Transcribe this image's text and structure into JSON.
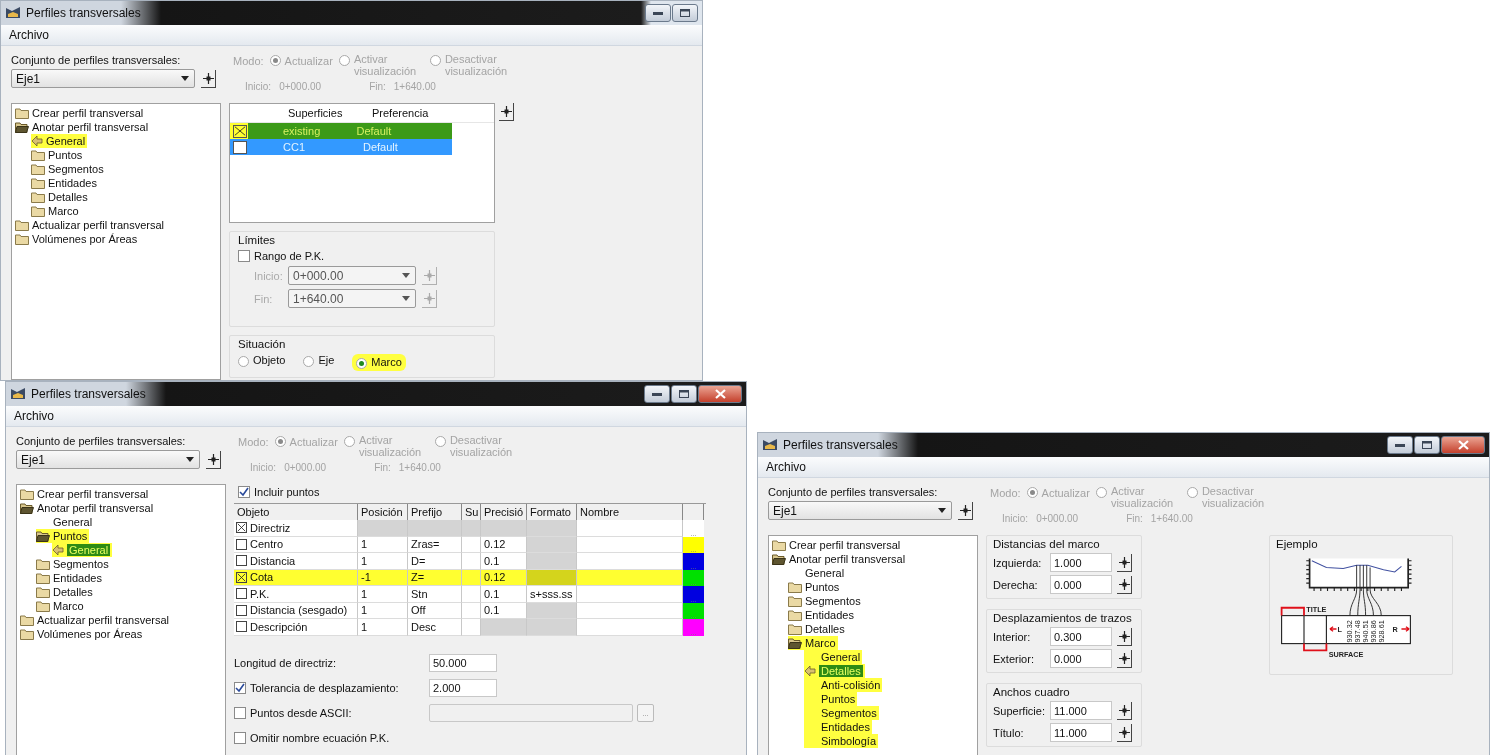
{
  "windows": [
    {
      "title": "Perfiles transversales",
      "close_visible": false,
      "menu": [
        "Archivo"
      ],
      "set_label": "Conjunto de perfiles transversales:",
      "set_value": "Eje1",
      "mode": {
        "label": "Modo:",
        "disabled": true,
        "options": [
          {
            "label": "Actualizar",
            "selected": true
          },
          {
            "label": "Activar visualización",
            "selected": false
          },
          {
            "label": "Desactivar visualización",
            "selected": false
          }
        ]
      },
      "start": {
        "label": "Inicio:",
        "value": "0+000.00"
      },
      "end": {
        "label": "Fin:",
        "value": "1+640.00"
      },
      "tree": [
        {
          "label": "Crear perfil transversal",
          "kind": "folder",
          "selected": false,
          "highlighted": false
        },
        {
          "label": "Anotar perfil transversal",
          "kind": "folder-open",
          "selected": false,
          "highlighted": false,
          "children": [
            {
              "label": "General",
              "kind": "current",
              "selected": false,
              "highlighted": true
            },
            {
              "label": "Puntos",
              "kind": "folder",
              "selected": false,
              "highlighted": false
            },
            {
              "label": "Segmentos",
              "kind": "folder",
              "selected": false,
              "highlighted": false
            },
            {
              "label": "Entidades",
              "kind": "folder",
              "selected": false,
              "highlighted": false
            },
            {
              "label": "Detalles",
              "kind": "folder",
              "selected": false,
              "highlighted": false
            },
            {
              "label": "Marco",
              "kind": "folder",
              "selected": false,
              "highlighted": false
            }
          ]
        },
        {
          "label": "Actualizar perfil transversal",
          "kind": "folder",
          "selected": false,
          "highlighted": false
        },
        {
          "label": "Volúmenes por Áreas",
          "kind": "folder",
          "selected": false,
          "highlighted": false
        }
      ],
      "pane": {
        "kind": "surfaces",
        "columns": [
          "Superficies",
          "Preferencia"
        ],
        "rows": [
          {
            "checked": true,
            "surface": "existing",
            "preference": "Default",
            "selected": true,
            "highlighted": true
          },
          {
            "checked": false,
            "surface": "CC1",
            "preference": "Default",
            "selected": true,
            "highlighted": false
          }
        ],
        "limits": {
          "title": "Límites",
          "range": {
            "label": "Rango de P.K.",
            "checked": false
          },
          "fields": [
            {
              "label": "Inicio:",
              "value": "0+000.00",
              "disabled": true
            },
            {
              "label": "Fin:",
              "value": "1+640.00",
              "disabled": true
            }
          ]
        },
        "placement": {
          "title": "Situación",
          "options": [
            {
              "label": "Objeto",
              "selected": false,
              "highlighted": false
            },
            {
              "label": "Eje",
              "selected": false,
              "highlighted": false
            },
            {
              "label": "Marco",
              "selected": true,
              "highlighted": true
            }
          ]
        }
      }
    },
    {
      "title": "Perfiles transversales",
      "close_visible": true,
      "menu": [
        "Archivo"
      ],
      "set_label": "Conjunto de perfiles transversales:",
      "set_value": "Eje1",
      "mode": {
        "label": "Modo:",
        "disabled": true,
        "options": [
          {
            "label": "Actualizar",
            "selected": true
          },
          {
            "label": "Activar visualización",
            "selected": false
          },
          {
            "label": "Desactivar visualización",
            "selected": false
          }
        ]
      },
      "start": {
        "label": "Inicio:",
        "value": "0+000.00"
      },
      "end": {
        "label": "Fin:",
        "value": "1+640.00"
      },
      "tree": [
        {
          "label": "Crear perfil transversal",
          "kind": "folder",
          "selected": false,
          "highlighted": false
        },
        {
          "label": "Anotar perfil transversal",
          "kind": "folder-open",
          "selected": false,
          "highlighted": false,
          "children": [
            {
              "label": "General",
              "kind": "leaf",
              "selected": false,
              "highlighted": false
            },
            {
              "label": "Puntos",
              "kind": "folder-open",
              "selected": false,
              "highlighted": true,
              "children": [
                {
                  "label": "General",
                  "kind": "current",
                  "selected": true,
                  "highlighted": true
                }
              ]
            },
            {
              "label": "Segmentos",
              "kind": "folder",
              "selected": false,
              "highlighted": false
            },
            {
              "label": "Entidades",
              "kind": "folder",
              "selected": false,
              "highlighted": false
            },
            {
              "label": "Detalles",
              "kind": "folder",
              "selected": false,
              "highlighted": false
            },
            {
              "label": "Marco",
              "kind": "folder",
              "selected": false,
              "highlighted": false
            }
          ]
        },
        {
          "label": "Actualizar perfil transversal",
          "kind": "folder",
          "selected": false,
          "highlighted": false
        },
        {
          "label": "Volúmenes por Áreas",
          "kind": "folder",
          "selected": false,
          "highlighted": false
        }
      ],
      "pane": {
        "kind": "points",
        "include": {
          "label": "Incluir puntos",
          "checked": true
        },
        "columns": [
          "Objeto",
          "Posición",
          "Prefijo",
          "Su",
          "Precisió",
          "Formato",
          "Nombre"
        ],
        "rows": [
          {
            "checked": true,
            "highlighted": false,
            "button": "...",
            "cells": [
              {
                "text": "Directriz",
                "disabled": false
              },
              {
                "disabled": true
              },
              {
                "disabled": true
              },
              {
                "disabled": true
              },
              {
                "disabled": true
              },
              {
                "disabled": true
              },
              {
                "disabled": false
              }
            ]
          },
          {
            "checked": false,
            "highlighted": false,
            "button": "...",
            "color": "#ffff00",
            "cells": [
              {
                "text": "Centro",
                "disabled": false
              },
              {
                "text": "1",
                "disabled": false
              },
              {
                "text": "Zras=",
                "disabled": false
              },
              {
                "disabled": false
              },
              {
                "text": "0.12",
                "disabled": false
              },
              {
                "disabled": true
              },
              {
                "disabled": false
              }
            ]
          },
          {
            "checked": false,
            "highlighted": false,
            "button": "...",
            "color": "#0000e0",
            "cells": [
              {
                "text": "Distancia",
                "disabled": false
              },
              {
                "text": "1",
                "disabled": false
              },
              {
                "text": "D=",
                "disabled": false
              },
              {
                "disabled": false
              },
              {
                "text": "0.1",
                "disabled": false
              },
              {
                "disabled": true
              },
              {
                "disabled": false
              }
            ]
          },
          {
            "checked": true,
            "highlighted": true,
            "button": "...",
            "color": "#00e000",
            "cells": [
              {
                "text": "Cota",
                "disabled": false
              },
              {
                "text": "-1",
                "disabled": false
              },
              {
                "text": "Z=",
                "disabled": false
              },
              {
                "disabled": false
              },
              {
                "text": "0.12",
                "disabled": false
              },
              {
                "disabled": true
              },
              {
                "disabled": false
              }
            ]
          },
          {
            "checked": false,
            "highlighted": false,
            "button": "...",
            "color": "#0000e0",
            "cells": [
              {
                "text": "P.K.",
                "disabled": false
              },
              {
                "text": "1",
                "disabled": false
              },
              {
                "text": "Stn",
                "disabled": false
              },
              {
                "disabled": false
              },
              {
                "text": "0.1",
                "disabled": false
              },
              {
                "text": "s+sss.ss",
                "disabled": false
              },
              {
                "disabled": false
              }
            ]
          },
          {
            "checked": false,
            "highlighted": false,
            "button": "...",
            "color": "#00e000",
            "cells": [
              {
                "text": "Distancia (sesgado)",
                "disabled": false
              },
              {
                "text": "1",
                "disabled": false
              },
              {
                "text": "Off",
                "disabled": false
              },
              {
                "disabled": false
              },
              {
                "text": "0.1",
                "disabled": false
              },
              {
                "disabled": true
              },
              {
                "disabled": false
              }
            ]
          },
          {
            "checked": false,
            "highlighted": false,
            "button": "...",
            "color": "#ff00ff",
            "cells": [
              {
                "text": "Descripción",
                "disabled": false
              },
              {
                "text": "1",
                "disabled": false
              },
              {
                "text": "Desc",
                "disabled": false
              },
              {
                "disabled": false
              },
              {
                "disabled": true
              },
              {
                "disabled": true
              },
              {
                "disabled": false
              }
            ]
          }
        ],
        "settings": [
          {
            "kind": "value",
            "label": "Longitud de directriz:",
            "value": "50.000"
          },
          {
            "kind": "checked-value",
            "label": "Tolerancia de desplazamiento:",
            "checked": true,
            "value": "2.000"
          },
          {
            "kind": "file",
            "label": "Puntos desde ASCII:",
            "checked": false,
            "button": "..."
          },
          {
            "kind": "check",
            "label": "Omitir nombre ecuación P.K.",
            "checked": false
          }
        ]
      }
    },
    {
      "title": "Perfiles transversales",
      "close_visible": true,
      "menu": [
        "Archivo"
      ],
      "set_label": "Conjunto de perfiles transversales:",
      "set_value": "Eje1",
      "mode": {
        "label": "Modo:",
        "disabled": true,
        "options": [
          {
            "label": "Actualizar",
            "selected": true
          },
          {
            "label": "Activar visualización",
            "selected": false
          },
          {
            "label": "Desactivar visualización",
            "selected": false
          }
        ]
      },
      "start": {
        "label": "Inicio:",
        "value": "0+000.00"
      },
      "end": {
        "label": "Fin:",
        "value": "1+640.00"
      },
      "tree": [
        {
          "label": "Crear perfil transversal",
          "kind": "folder",
          "selected": false,
          "highlighted": false
        },
        {
          "label": "Anotar perfil transversal",
          "kind": "folder-open",
          "selected": false,
          "highlighted": false,
          "children": [
            {
              "label": "General",
              "kind": "leaf",
              "selected": false,
              "highlighted": false
            },
            {
              "label": "Puntos",
              "kind": "folder",
              "selected": false,
              "highlighted": false
            },
            {
              "label": "Segmentos",
              "kind": "folder",
              "selected": false,
              "highlighted": false
            },
            {
              "label": "Entidades",
              "kind": "folder",
              "selected": false,
              "highlighted": false
            },
            {
              "label": "Detalles",
              "kind": "folder",
              "selected": false,
              "highlighted": false
            },
            {
              "label": "Marco",
              "kind": "folder-open",
              "selected": false,
              "highlighted": true,
              "children": [
                {
                  "label": "General",
                  "kind": "leaf",
                  "selected": false,
                  "highlighted": true
                },
                {
                  "label": "Detalles",
                  "kind": "current",
                  "selected": true,
                  "highlighted": true
                },
                {
                  "label": "Anti-colisión",
                  "kind": "leaf",
                  "selected": false,
                  "highlighted": true
                },
                {
                  "label": "Puntos",
                  "kind": "leaf",
                  "selected": false,
                  "highlighted": true
                },
                {
                  "label": "Segmentos",
                  "kind": "leaf",
                  "selected": false,
                  "highlighted": true
                },
                {
                  "label": "Entidades",
                  "kind": "leaf",
                  "selected": false,
                  "highlighted": true
                },
                {
                  "label": "Simbología",
                  "kind": "leaf",
                  "selected": false,
                  "highlighted": true
                }
              ]
            }
          ]
        }
      ],
      "pane": {
        "kind": "frame",
        "groups": [
          {
            "title": "Distancias del marco",
            "fields": [
              {
                "label": "Izquierda:",
                "value": "1.000"
              },
              {
                "label": "Derecha:",
                "value": "0.000"
              }
            ]
          },
          {
            "title": "Desplazamientos de trazos",
            "fields": [
              {
                "label": "Interior:",
                "value": "0.300"
              },
              {
                "label": "Exterior:",
                "value": "0.000"
              }
            ]
          },
          {
            "title": "Anchos cuadro",
            "fields": [
              {
                "label": "Superficie:",
                "value": "11.000"
              },
              {
                "label": "Título:",
                "value": "11.000"
              }
            ]
          }
        ],
        "example": {
          "title": "Ejemplo",
          "title_label": "TITLE",
          "surface_label": "SURFACE",
          "left_label": "L",
          "right_label": "R",
          "values": [
            "930.32",
            "937.48",
            "940.51",
            "936.86",
            "928.61"
          ]
        }
      }
    }
  ]
}
